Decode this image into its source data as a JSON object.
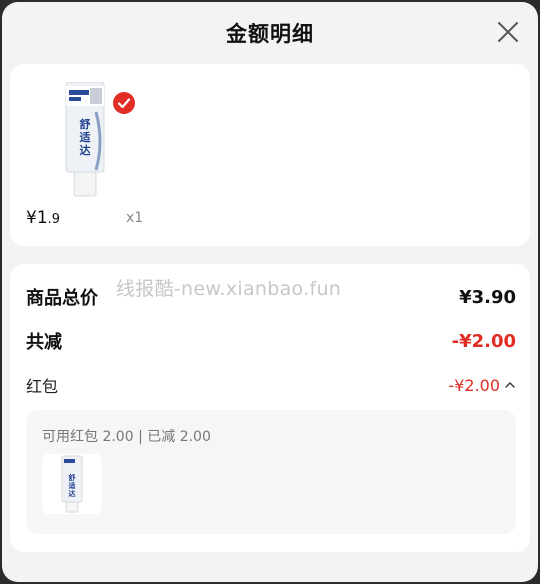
{
  "header": {
    "title": "金额明细"
  },
  "product": {
    "brand_text": "舒适达",
    "price_symbol_main": "¥1",
    "price_cents": ".9",
    "quantity": "x1"
  },
  "summary": {
    "watermark": "线报酷-new.xianbao.fun",
    "total_label": "商品总价",
    "total_value": "¥3.90",
    "reduce_label": "共减",
    "reduce_value": "-¥2.00",
    "hongbao_label": "红包",
    "hongbao_value": "-¥2.00",
    "hongbao_detail": "可用红包 2.00 | 已减 2.00"
  },
  "colors": {
    "accent_red": "#e02e24"
  }
}
